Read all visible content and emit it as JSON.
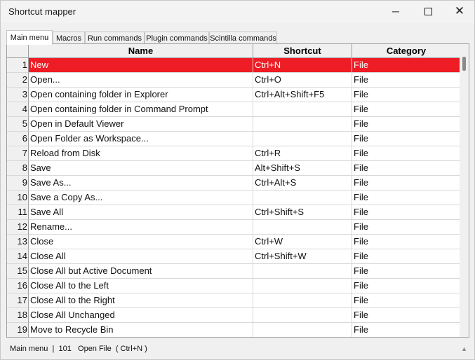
{
  "window": {
    "title": "Shortcut mapper"
  },
  "tabs": [
    "Main menu",
    "Macros",
    "Run commands",
    "Plugin commands",
    "Scintilla commands"
  ],
  "columns": {
    "name": "Name",
    "shortcut": "Shortcut",
    "category": "Category"
  },
  "rows": [
    {
      "n": "1",
      "name": "New",
      "shortcut": "Ctrl+N",
      "category": "File"
    },
    {
      "n": "2",
      "name": "Open...",
      "shortcut": "Ctrl+O",
      "category": "File"
    },
    {
      "n": "3",
      "name": "Open containing folder in Explorer",
      "shortcut": "Ctrl+Alt+Shift+F5",
      "category": "File"
    },
    {
      "n": "4",
      "name": "Open containing folder in Command Prompt",
      "shortcut": "",
      "category": "File"
    },
    {
      "n": "5",
      "name": "Open in Default Viewer",
      "shortcut": "",
      "category": "File"
    },
    {
      "n": "6",
      "name": "Open Folder as Workspace...",
      "shortcut": "",
      "category": "File"
    },
    {
      "n": "7",
      "name": "Reload from Disk",
      "shortcut": "Ctrl+R",
      "category": "File"
    },
    {
      "n": "8",
      "name": "Save",
      "shortcut": "Alt+Shift+S",
      "category": "File"
    },
    {
      "n": "9",
      "name": "Save As...",
      "shortcut": "Ctrl+Alt+S",
      "category": "File"
    },
    {
      "n": "10",
      "name": "Save a Copy As...",
      "shortcut": "",
      "category": "File"
    },
    {
      "n": "11",
      "name": "Save All",
      "shortcut": "Ctrl+Shift+S",
      "category": "File"
    },
    {
      "n": "12",
      "name": "Rename...",
      "shortcut": "",
      "category": "File"
    },
    {
      "n": "13",
      "name": "Close",
      "shortcut": "Ctrl+W",
      "category": "File"
    },
    {
      "n": "14",
      "name": "Close All",
      "shortcut": "Ctrl+Shift+W",
      "category": "File"
    },
    {
      "n": "15",
      "name": "Close All but Active Document",
      "shortcut": "",
      "category": "File"
    },
    {
      "n": "16",
      "name": "Close All to the Left",
      "shortcut": "",
      "category": "File"
    },
    {
      "n": "17",
      "name": "Close All to the Right",
      "shortcut": "",
      "category": "File"
    },
    {
      "n": "18",
      "name": "Close All Unchanged",
      "shortcut": "",
      "category": "File"
    },
    {
      "n": "19",
      "name": "Move to Recycle Bin",
      "shortcut": "",
      "category": "File"
    }
  ],
  "selected_row": 0,
  "status": "Main menu  |  101   Open File  ( Ctrl+N )",
  "colors": {
    "selection": "#ee1c24"
  },
  "icons": {
    "minimize": "minimize-icon",
    "maximize": "maximize-icon",
    "close": "close-icon"
  }
}
